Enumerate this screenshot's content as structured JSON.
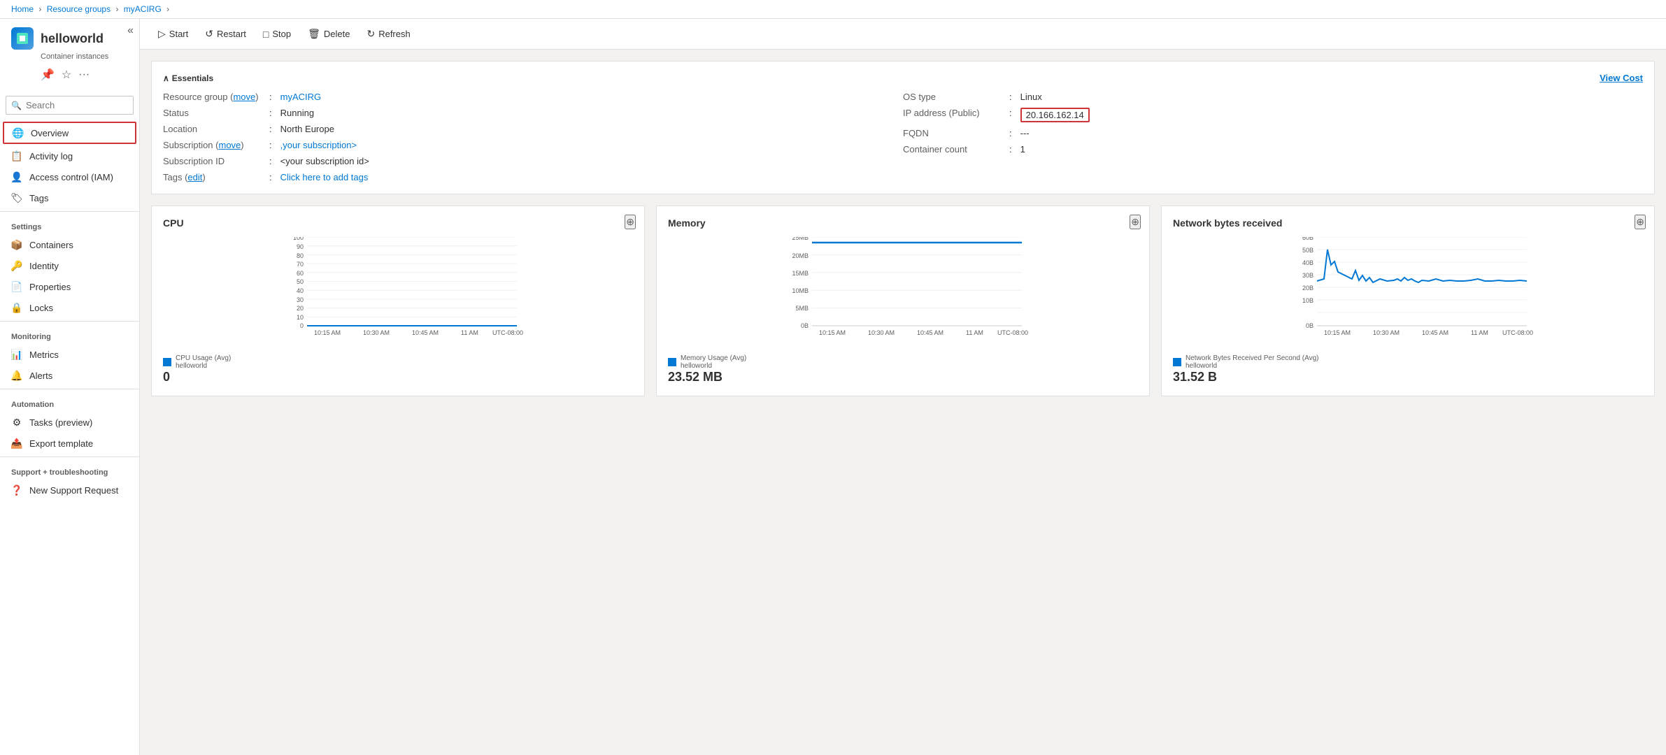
{
  "breadcrumb": {
    "items": [
      "Home",
      "Resource groups",
      "myACIRG"
    ]
  },
  "sidebar": {
    "title": "helloworld",
    "subtitle": "Container instances",
    "pin_icon": "📌",
    "star_icon": "☆",
    "more_icon": "...",
    "search_placeholder": "Search",
    "collapse_icon": "«",
    "items": [
      {
        "id": "overview",
        "label": "Overview",
        "icon": "🌐",
        "active": true,
        "highlight_red": true
      },
      {
        "id": "activity-log",
        "label": "Activity log",
        "icon": "📋",
        "active": false
      },
      {
        "id": "access-control",
        "label": "Access control (IAM)",
        "icon": "👤",
        "active": false
      },
      {
        "id": "tags",
        "label": "Tags",
        "icon": "🏷",
        "active": false
      }
    ],
    "sections": [
      {
        "title": "Settings",
        "items": [
          {
            "id": "containers",
            "label": "Containers",
            "icon": "📦"
          },
          {
            "id": "identity",
            "label": "Identity",
            "icon": "🔑"
          },
          {
            "id": "properties",
            "label": "Properties",
            "icon": "📄"
          },
          {
            "id": "locks",
            "label": "Locks",
            "icon": "🔒"
          }
        ]
      },
      {
        "title": "Monitoring",
        "items": [
          {
            "id": "metrics",
            "label": "Metrics",
            "icon": "📊"
          },
          {
            "id": "alerts",
            "label": "Alerts",
            "icon": "🔔"
          }
        ]
      },
      {
        "title": "Automation",
        "items": [
          {
            "id": "tasks",
            "label": "Tasks (preview)",
            "icon": "⚙"
          },
          {
            "id": "export-template",
            "label": "Export template",
            "icon": "📤"
          }
        ]
      },
      {
        "title": "Support + troubleshooting",
        "items": [
          {
            "id": "new-support-request",
            "label": "New Support Request",
            "icon": "❓"
          }
        ]
      }
    ]
  },
  "toolbar": {
    "start_label": "Start",
    "restart_label": "Restart",
    "stop_label": "Stop",
    "delete_label": "Delete",
    "refresh_label": "Refresh"
  },
  "essentials": {
    "title": "Essentials",
    "view_cost_label": "View Cost",
    "left": [
      {
        "label": "Resource group (move)",
        "value": "myACIRG",
        "link": true
      },
      {
        "label": "Status",
        "value": "Running"
      },
      {
        "label": "Location",
        "value": "North Europe"
      },
      {
        "label": "Subscription (move)",
        "value": ",your subscription>",
        "link": true
      },
      {
        "label": "Subscription ID",
        "value": "<your subscription id>"
      },
      {
        "label": "Tags (edit)",
        "value": "Click here to add tags",
        "link": true
      }
    ],
    "right": [
      {
        "label": "OS type",
        "value": "Linux"
      },
      {
        "label": "IP address (Public)",
        "value": "20.166.162.14",
        "highlight": true
      },
      {
        "label": "FQDN",
        "value": "---"
      },
      {
        "label": "Container count",
        "value": "1"
      }
    ]
  },
  "charts": {
    "cpu": {
      "title": "CPU",
      "y_labels": [
        "100",
        "90",
        "80",
        "70",
        "60",
        "50",
        "40",
        "30",
        "20",
        "10",
        "0"
      ],
      "x_labels": [
        "10:15 AM",
        "10:30 AM",
        "10:45 AM",
        "11 AM",
        "UTC-08:00"
      ],
      "legend_label": "CPU Usage (Avg)",
      "legend_sublabel": "helloworld",
      "value": "0"
    },
    "memory": {
      "title": "Memory",
      "y_labels": [
        "25MB",
        "20MB",
        "15MB",
        "10MB",
        "5MB",
        "0B"
      ],
      "x_labels": [
        "10:15 AM",
        "10:30 AM",
        "10:45 AM",
        "11 AM",
        "UTC-08:00"
      ],
      "legend_label": "Memory Usage (Avg)",
      "legend_sublabel": "helloworld",
      "value": "23.52 MB"
    },
    "network": {
      "title": "Network bytes received",
      "y_labels": [
        "60B",
        "50B",
        "40B",
        "30B",
        "20B",
        "10B",
        "0B"
      ],
      "x_labels": [
        "10:15 AM",
        "10:30 AM",
        "10:45 AM",
        "11 AM",
        "UTC-08:00"
      ],
      "legend_label": "Network Bytes Received Per Second (Avg)",
      "legend_sublabel": "helloworld",
      "value": "31.52 B"
    }
  }
}
